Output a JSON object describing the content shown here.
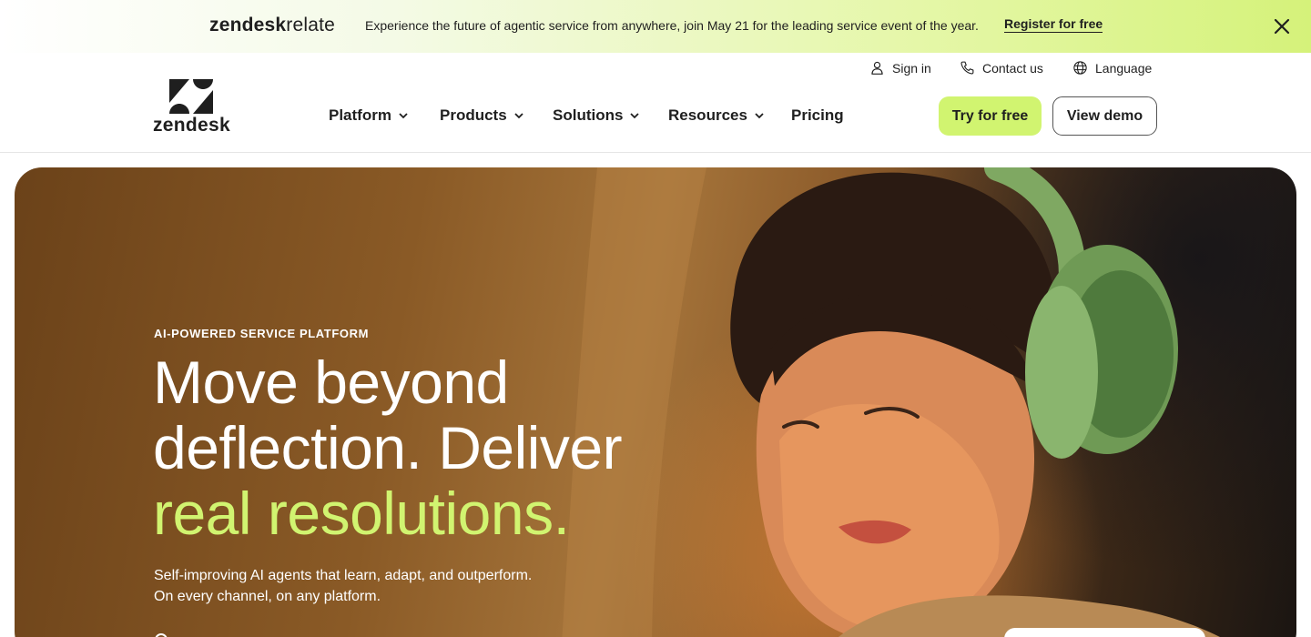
{
  "banner": {
    "brand_bold": "zendesk",
    "brand_light": "relate",
    "text": "Experience the future of agentic service from anywhere, join May 21 for the leading service event of the year.",
    "link": "Register for free",
    "close_icon": "close-icon"
  },
  "utility": {
    "signin": "Sign in",
    "contact": "Contact us",
    "language": "Language"
  },
  "logo": {
    "wordmark": "zendesk"
  },
  "nav": {
    "items": [
      {
        "label": "Platform",
        "has_dropdown": true
      },
      {
        "label": "Products",
        "has_dropdown": true
      },
      {
        "label": "Solutions",
        "has_dropdown": true
      },
      {
        "label": "Resources",
        "has_dropdown": true
      },
      {
        "label": "Pricing",
        "has_dropdown": false
      }
    ],
    "try_free": "Try for free",
    "view_demo": "View demo"
  },
  "hero": {
    "eyebrow": "AI-POWERED SERVICE PLATFORM",
    "headline_line1": "Move beyond",
    "headline_line2": "deflection. Deliver",
    "headline_accent": "real resolutions.",
    "sub_line1": "Self-improving AI agents that learn, adapt, and outperform.",
    "sub_line2": "On every channel, on any platform."
  },
  "colors": {
    "accent": "#d1f470",
    "text_dark": "#1f1f1f",
    "hero_brown": "#8a5a26"
  }
}
